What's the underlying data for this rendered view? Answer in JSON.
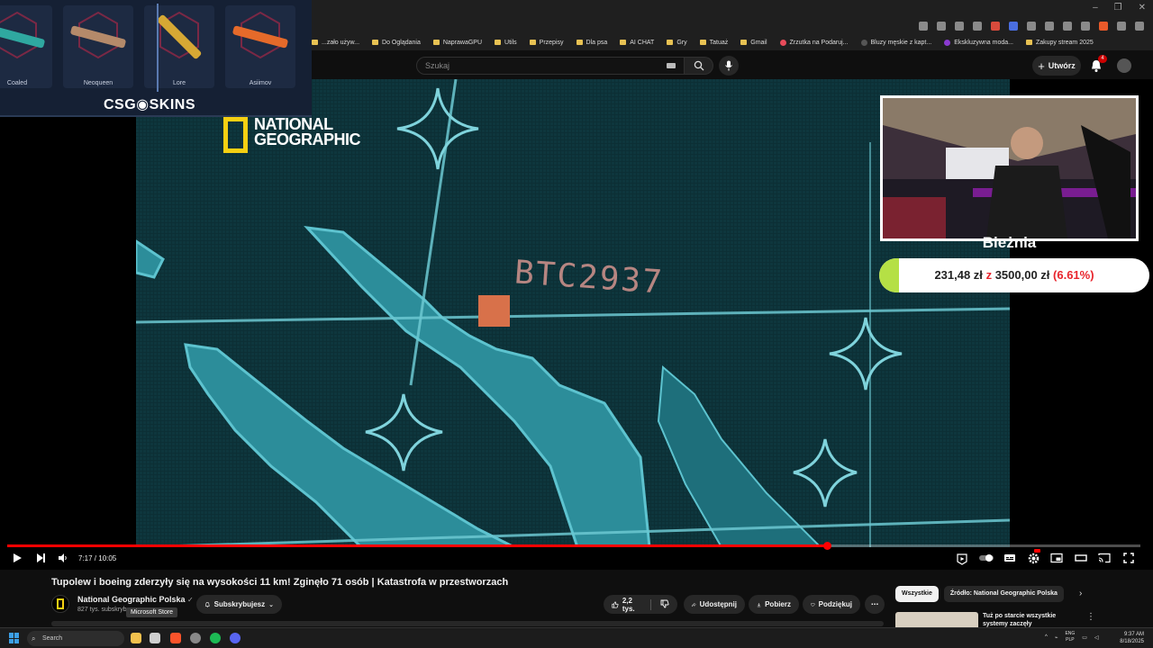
{
  "browser": {
    "bookmarks": [
      {
        "label": "...zało używ...",
        "type": "folder"
      },
      {
        "label": "Do Oglądania",
        "type": "folder"
      },
      {
        "label": "NaprawaGPU",
        "type": "folder"
      },
      {
        "label": "Utils",
        "type": "folder"
      },
      {
        "label": "Przepisy",
        "type": "folder"
      },
      {
        "label": "Dla psa",
        "type": "folder"
      },
      {
        "label": "AI CHAT",
        "type": "folder"
      },
      {
        "label": "Gry",
        "type": "folder"
      },
      {
        "label": "Tatuaż",
        "type": "folder"
      },
      {
        "label": "Gmail",
        "type": "folder"
      },
      {
        "label": "Zrzutka na Podaruj...",
        "type": "site"
      },
      {
        "label": "Bluzy męskie z kapt...",
        "type": "site"
      },
      {
        "label": "Ekskluzywna moda...",
        "type": "site"
      },
      {
        "label": "Zakupy stream 2025",
        "type": "folder"
      }
    ]
  },
  "youtube": {
    "search_placeholder": "Szukaj",
    "create_label": "Utwórz",
    "notification_count": "4"
  },
  "overlay_skins": {
    "items": [
      "Coaled",
      "Neoqueen",
      "Lore",
      "Asiimov"
    ],
    "brand": "CSG◉SKINS"
  },
  "video": {
    "watermark_line1": "NATIONAL",
    "watermark_line2": "GEOGRAPHIC",
    "flight_label": "BTC2937",
    "current_time": "7:17",
    "duration": "10:05",
    "time_display": "7:17 / 10:05",
    "progress_fraction": 0.723
  },
  "stream_overlay": {
    "goal_title": "Bieżnia",
    "goal_current": "231,48 zł",
    "goal_separator": "z",
    "goal_target": "3500,00 zł",
    "goal_percent": "(6.61%)",
    "goal_fraction": 0.066
  },
  "details": {
    "title": "Tupolew i boeing zderzyły się na wysokości 11 km! Zginęło 71 osób | Katastrofa w przestworzach",
    "channel_name": "National Geographic Polska",
    "subscribers": "827 tys. subskrybe...",
    "tooltip": "Microsoft Store",
    "subscribe_label": "Subskrybujesz",
    "likes": "2,2 tys.",
    "share_label": "Udostępnij",
    "download_label": "Pobierz",
    "thanks_label": "Podziękuj",
    "more_label": "⋯"
  },
  "sidebar": {
    "chips": [
      "Wszystkie",
      "Źródło: National Geographic Polska"
    ],
    "recommendation_title": "Tuż po starcie wszystkie systemy zaczęły wariować! |"
  },
  "taskbar": {
    "search_label": "Search",
    "lang_line1": "ENG",
    "lang_line2": "PLP",
    "time": "9:37 AM",
    "date": "8/18/2025"
  },
  "colors": {
    "youtube_red": "#ff0000",
    "natgeo_yellow": "#f6d012",
    "goal_green": "#b5e045",
    "percent_red": "#e8242c"
  }
}
